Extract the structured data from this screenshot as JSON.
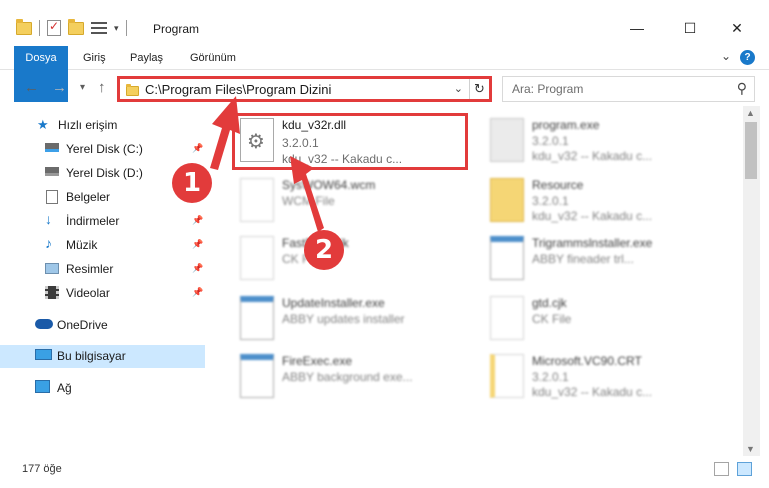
{
  "window": {
    "title": "Program",
    "minimize": "—",
    "maximize": "☐",
    "close": "✕"
  },
  "ribbon": {
    "tabs": [
      "Dosya",
      "Giriş",
      "Paylaş",
      "Görünüm"
    ],
    "help": "?"
  },
  "nav": {
    "back": "←",
    "forward": "→",
    "recent": "▾",
    "up": "↑",
    "address": "C:\\Program Files\\Program Dizini",
    "refresh": "↻",
    "search_placeholder": "Ara: Program"
  },
  "sidebar": {
    "items": [
      {
        "label": "Hızlı erişim",
        "icon": "star-icon",
        "pinned": false
      },
      {
        "label": "Yerel Disk (C:)",
        "icon": "drive-icon",
        "pinned": true
      },
      {
        "label": "Yerel Disk (D:)",
        "icon": "drive-icon",
        "pinned": true
      },
      {
        "label": "Belgeler",
        "icon": "documents-icon",
        "pinned": true
      },
      {
        "label": "İndirmeler",
        "icon": "download-icon",
        "pinned": true
      },
      {
        "label": "Müzik",
        "icon": "music-icon",
        "pinned": true
      },
      {
        "label": "Resimler",
        "icon": "pictures-icon",
        "pinned": true
      },
      {
        "label": "Videolar",
        "icon": "videos-icon",
        "pinned": true
      },
      {
        "label": "OneDrive",
        "icon": "cloud-icon",
        "pinned": false
      },
      {
        "label": "Bu bilgisayar",
        "icon": "computer-icon",
        "pinned": false,
        "selected": true
      },
      {
        "label": "Ağ",
        "icon": "network-icon",
        "pinned": false
      }
    ]
  },
  "files": [
    {
      "name": "kdu_v32r.dll",
      "line2": "3.2.0.1",
      "line3": "kdu_v32 -- Kakadu c..."
    },
    {
      "name": "program.exe",
      "line2": "3.2.0.1",
      "line3": "kdu_v32 -- Kakadu c..."
    },
    {
      "name": "SysWOW64.wcm",
      "line2": "WCM File",
      "line3": ""
    },
    {
      "name": "Resource",
      "line2": "3.2.0.1",
      "line3": "kdu_v32 -- Kakadu c..."
    },
    {
      "name": "FastFiles.cjk",
      "line2": "CK File",
      "line3": ""
    },
    {
      "name": "Trigrammslnstaller.exe",
      "line2": "ABBY fineader trl...",
      "line3": ""
    },
    {
      "name": "UpdateInstaller.exe",
      "line2": "ABBY updates installer",
      "line3": ""
    },
    {
      "name": "gtd.cjk",
      "line2": "CK File",
      "line3": ""
    },
    {
      "name": "FireExec.exe",
      "line2": "ABBY background exe...",
      "line3": ""
    },
    {
      "name": "Microsoft.VC90.CRT",
      "line2": "3.2.0.1",
      "line3": "kdu_v32 -- Kakadu c..."
    }
  ],
  "callouts": [
    "1",
    "2"
  ],
  "status": {
    "count": "177 öğe"
  },
  "colors": {
    "accent": "#1979ca",
    "highlight": "#e23b3b",
    "selected": "#cce8ff"
  }
}
